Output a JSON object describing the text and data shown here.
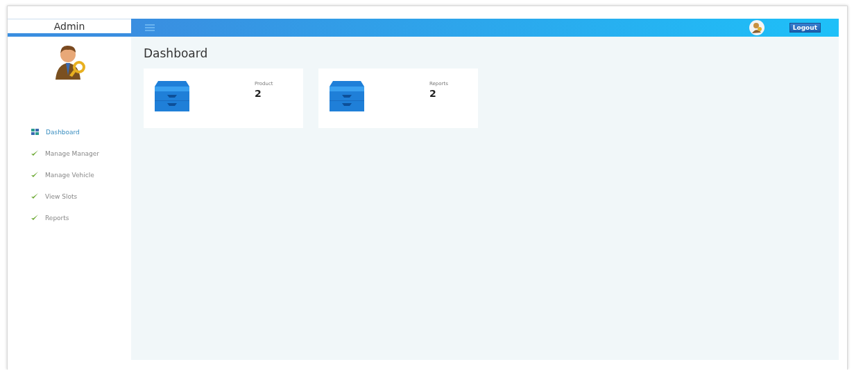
{
  "brand": "Admin",
  "header": {
    "logout": "Logout"
  },
  "sidebar": {
    "items": [
      {
        "label": "Dashboard",
        "kind": "dashboard",
        "selected": true
      },
      {
        "label": "Manage Manager",
        "kind": "check",
        "selected": false
      },
      {
        "label": "Manage Vehicle",
        "kind": "check",
        "selected": false
      },
      {
        "label": "View Slots",
        "kind": "check",
        "selected": false
      },
      {
        "label": "Reports",
        "kind": "check",
        "selected": false
      }
    ]
  },
  "page": {
    "title": "Dashboard"
  },
  "cards": [
    {
      "label": "Product",
      "value": "2"
    },
    {
      "label": "Reports",
      "value": "2"
    }
  ]
}
